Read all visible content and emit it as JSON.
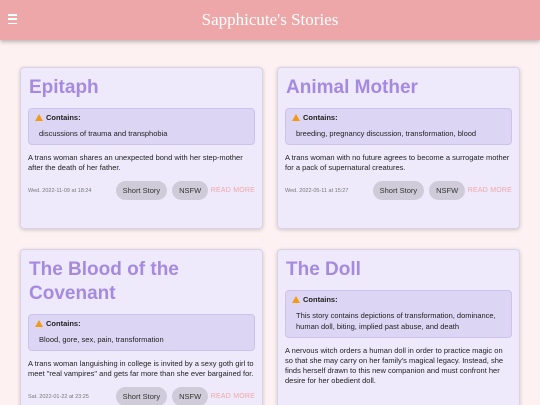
{
  "appbar": {
    "title": "Sapphicute's Stories"
  },
  "cards": [
    {
      "title": "Epitaph",
      "contains_label": "Contains:",
      "warnings": "discussions of trauma and transphobia",
      "description": "A trans woman shares an unexpected bond with her step-mother after the death of her father.",
      "date": "Wed. 2022-11-09 at 18:24",
      "tags": [
        "Short Story",
        "NSFW"
      ],
      "read_more": "READ MORE"
    },
    {
      "title": "Animal Mother",
      "contains_label": "Contains:",
      "warnings": "breeding, pregnancy discussion, transformation, blood",
      "description": "A trans woman with no future agrees to become a surrogate mother for a pack of supernatural creatures.",
      "date": "Wed. 2022-05-11 at 15:27",
      "tags": [
        "Short Story",
        "NSFW"
      ],
      "read_more": "READ MORE"
    },
    {
      "title": "The Blood of the Covenant",
      "contains_label": "Contains:",
      "warnings": "Blood, gore, sex, pain, transformation",
      "description": "A trans woman languishing in college is invited by a sexy goth girl to meet \"real vampires\" and gets far more than she ever bargained for.",
      "date": "Sat. 2022-01-22 at 23:25",
      "tags": [
        "Short Story",
        "NSFW"
      ],
      "read_more": "READ MORE"
    },
    {
      "title": "The Doll",
      "contains_label": "Contains:",
      "warnings": "This story contains depictions of transformation, dominance, human doll, biting, implied past abuse, and death",
      "description": "A nervous witch orders a human doll in order to practice magic on so that she may carry on her family's magical legacy. Instead, she finds herself drawn to this new companion and must confront her desire for her obedient doll."
    }
  ],
  "colors": {
    "appbar": "#eea7a8",
    "title": "#a58ae0",
    "card": "#eeeafb",
    "read_more": "#f0a7a7",
    "warning_icon": "#f39a12"
  }
}
